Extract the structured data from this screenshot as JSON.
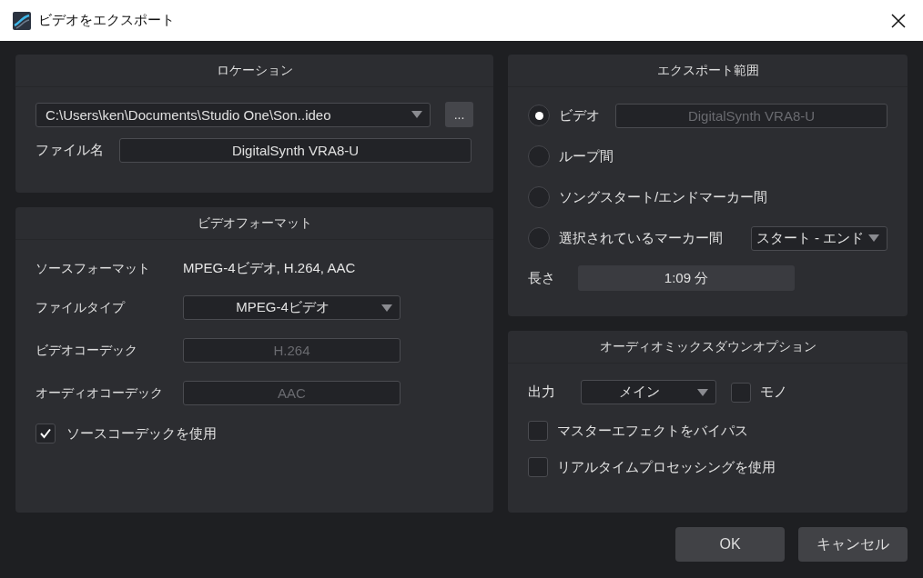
{
  "window": {
    "title": "ビデオをエクスポート"
  },
  "location": {
    "title": "ロケーション",
    "path": {
      "value": "C:\\Users\\ken\\Documents\\Studio One\\Son..ideo"
    },
    "browse_button": {
      "label": "..."
    },
    "filename": {
      "label": "ファイル名",
      "value": "DigitalSynth VRA8-U"
    }
  },
  "video_format": {
    "title": "ビデオフォーマット",
    "source_format": {
      "label": "ソースフォーマット",
      "value": "MPEG-4ビデオ, H.264, AAC"
    },
    "fields": [
      {
        "label": "ファイルタイプ",
        "value": "MPEG-4ビデオ",
        "kind": "dropdown",
        "disabled": false
      },
      {
        "label": "ビデオコーデック",
        "value": "H.264",
        "kind": "field",
        "disabled": true
      },
      {
        "label": "オーディオコーデック",
        "value": "AAC",
        "kind": "field",
        "disabled": true
      }
    ],
    "use_source_codec": {
      "label": "ソースコーデックを使用",
      "checked": true
    }
  },
  "export_range": {
    "title": "エクスポート範囲",
    "options": [
      {
        "label": "ビデオ",
        "selected": true,
        "kind": "field",
        "value": "DigitalSynth VRA8-U"
      },
      {
        "label": "ループ間",
        "selected": false,
        "kind": "plain"
      },
      {
        "label": "ソングスタート/エンドマーカー間",
        "selected": false,
        "kind": "plain"
      },
      {
        "label": "選択されているマーカー間",
        "selected": false,
        "kind": "dropdown",
        "value": "スタート - エンド"
      }
    ],
    "length": {
      "label": "長さ",
      "value": "1:09 分"
    }
  },
  "audio_mixdown": {
    "title": "オーディオミックスダウンオプション",
    "output": {
      "label": "出力",
      "value": "メイン"
    },
    "mono": {
      "label": "モノ",
      "checked": false
    },
    "checkboxes": [
      {
        "label": "マスターエフェクトをバイパス",
        "checked": false
      },
      {
        "label": "リアルタイムプロセッシングを使用",
        "checked": false
      }
    ]
  },
  "buttons": [
    {
      "label": "OK"
    },
    {
      "label": "キャンセル"
    }
  ]
}
